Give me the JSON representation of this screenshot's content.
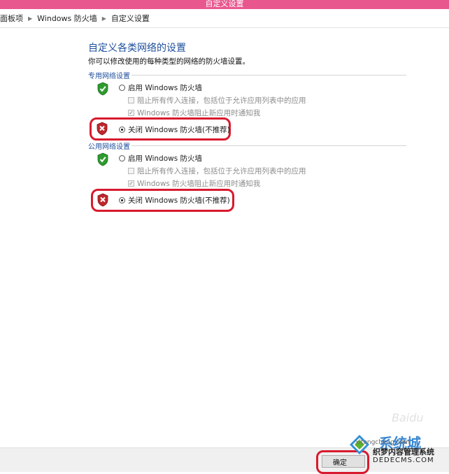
{
  "window": {
    "title": "自定义设置"
  },
  "breadcrumb": {
    "items": [
      "面板项",
      "Windows 防火墙",
      "自定义设置"
    ]
  },
  "page": {
    "title": "自定义各类网络的设置",
    "description": "你可以修改使用的每种类型的网络的防火墙设置。"
  },
  "private_section": {
    "header": "专用网络设置",
    "enable_label": "启用 Windows 防火墙",
    "block_all_label": "阻止所有传入连接，包括位于允许应用列表中的应用",
    "notify_label": "Windows 防火墙阻止新应用时通知我",
    "disable_label": "关闭 Windows 防火墙(不推荐)",
    "selected": "disable",
    "notify_checked": true
  },
  "public_section": {
    "header": "公用网络设置",
    "enable_label": "启用 Windows 防火墙",
    "block_all_label": "阻止所有传入连接，包括位于允许应用列表中的应用",
    "notify_label": "Windows 防火墙阻止新应用时通知我",
    "disable_label": "关闭 Windows 防火墙(不推荐)",
    "selected": "disable",
    "notify_checked": true
  },
  "footer": {
    "ok_label": "确定"
  },
  "watermarks": {
    "baidu": "Baidu",
    "xitong_brand": "系统城",
    "xitong_url": "xitongcheng.com",
    "dede_brand": "织梦内容管理系统",
    "dede_url": "DEDECMS.COM"
  },
  "colors": {
    "titlebar": "#e8588e",
    "link_blue": "#1e4f9c",
    "highlight_red": "#d81a2e",
    "shield_green": "#2e9b2e",
    "shield_red": "#c0262c"
  }
}
